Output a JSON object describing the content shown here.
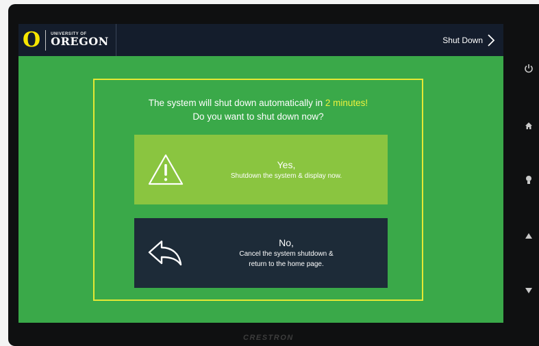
{
  "header": {
    "logo_mark": "O",
    "logo_small": "UNIVERSITY OF",
    "logo_big": "OREGON",
    "shutdown_label": "Shut Down"
  },
  "dialog": {
    "line1_prefix": "The system will shut down automatically in ",
    "line1_highlight": "2 minutes!",
    "line2": "Do you want to shut down now?",
    "yes": {
      "title": "Yes,",
      "subtitle": "Shutdown the system & display now.",
      "icon": "warning-icon"
    },
    "no": {
      "title": "No,",
      "subtitle_line1": "Cancel the system shutdown &",
      "subtitle_line2": "return to the home page.",
      "icon": "return-arrow-icon"
    }
  },
  "hardware_buttons": [
    "power-icon",
    "home-icon",
    "light-icon",
    "volume-up-icon",
    "volume-down-icon"
  ],
  "device": {
    "brand": "CRESTRON"
  },
  "colors": {
    "screen_bg": "#3aa949",
    "header_bg": "#141d2c",
    "panel_border": "#e5e934",
    "yes_bg": "#8ac540",
    "no_bg": "#1d2b38",
    "highlight": "#eef33e"
  }
}
